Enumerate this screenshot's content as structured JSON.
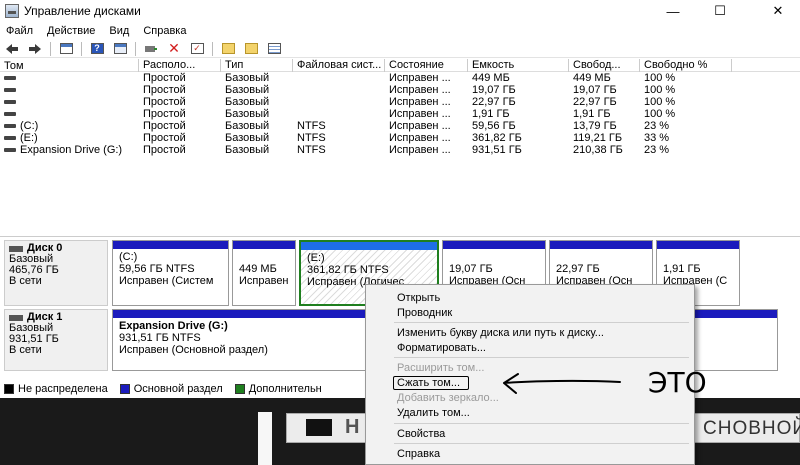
{
  "window": {
    "title": "Управление дисками",
    "minimize": "—",
    "maximize": "☐",
    "close": "✕"
  },
  "menu": [
    "Файл",
    "Действие",
    "Вид",
    "Справка"
  ],
  "toolbar_icons": [
    "back-icon",
    "forward-icon",
    "properties-icon",
    "help-icon",
    "console-icon",
    "connect-icon",
    "delete-icon",
    "check-icon",
    "new-folder-icon",
    "search-folder-icon",
    "list-icon"
  ],
  "volumes": {
    "headers": [
      "Том",
      "Располо...",
      "Тип",
      "Файловая сист...",
      "Состояние",
      "Емкость",
      "Свобод...",
      "Свободно %"
    ],
    "rows": [
      [
        "",
        "Простой",
        "Базовый",
        "",
        "Исправен ...",
        "449 МБ",
        "449 МБ",
        "100 %"
      ],
      [
        "",
        "Простой",
        "Базовый",
        "",
        "Исправен ...",
        "19,07 ГБ",
        "19,07 ГБ",
        "100 %"
      ],
      [
        "",
        "Простой",
        "Базовый",
        "",
        "Исправен ...",
        "22,97 ГБ",
        "22,97 ГБ",
        "100 %"
      ],
      [
        "",
        "Простой",
        "Базовый",
        "",
        "Исправен ...",
        "1,91 ГБ",
        "1,91 ГБ",
        "100 %"
      ],
      [
        "(C:)",
        "Простой",
        "Базовый",
        "NTFS",
        "Исправен ...",
        "59,56 ГБ",
        "13,79 ГБ",
        "23 %"
      ],
      [
        "(E:)",
        "Простой",
        "Базовый",
        "NTFS",
        "Исправен ...",
        "361,82 ГБ",
        "119,21 ГБ",
        "33 %"
      ],
      [
        "Expansion Drive (G:)",
        "Простой",
        "Базовый",
        "NTFS",
        "Исправен ...",
        "931,51 ГБ",
        "210,38 ГБ",
        "23 %"
      ]
    ]
  },
  "disks": [
    {
      "name": "Диск 0",
      "type": "Базовый",
      "size": "465,76 ГБ",
      "status": "В сети",
      "partitions": [
        {
          "title": "(C:)",
          "size": "59,56 ГБ NTFS",
          "status": "Исправен (Систем"
        },
        {
          "title": "",
          "size": "449 МБ",
          "status": "Исправен"
        },
        {
          "title": "(E:)",
          "size": "361,82 ГБ NTFS",
          "status": "Исправен (Логичес"
        },
        {
          "title": "",
          "size": "19,07 ГБ",
          "status": "Исправен (Осн"
        },
        {
          "title": "",
          "size": "22,97 ГБ",
          "status": "Исправен (Осн"
        },
        {
          "title": "",
          "size": "1,91 ГБ",
          "status": "Исправен (С"
        }
      ]
    },
    {
      "name": "Диск 1",
      "type": "Базовый",
      "size": "931,51 ГБ",
      "status": "В сети",
      "partitions": [
        {
          "title": "Expansion Drive  (G:)",
          "size": "931,51 ГБ NTFS",
          "status": "Исправен (Основной раздел)"
        }
      ]
    }
  ],
  "legend": [
    {
      "label": "Не распределена",
      "color": "#000000"
    },
    {
      "label": "Основной раздел",
      "color": "#1b1bbd"
    },
    {
      "label": "Дополнительн",
      "color": "#1f7f1f"
    }
  ],
  "context_menu": {
    "open": "Открыть",
    "explorer": "Проводник",
    "change_letter": "Изменить букву диска или путь к диску...",
    "format": "Форматировать...",
    "extend": "Расширить том...",
    "shrink": "Сжать том...",
    "mirror": "Добавить зеркало...",
    "delete": "Удалить том...",
    "properties": "Свойства",
    "help": "Справка"
  },
  "annotation": {
    "text": "ЭТО"
  },
  "background": {
    "left_text": "Н",
    "right_text": "СНОВНОЙ"
  }
}
